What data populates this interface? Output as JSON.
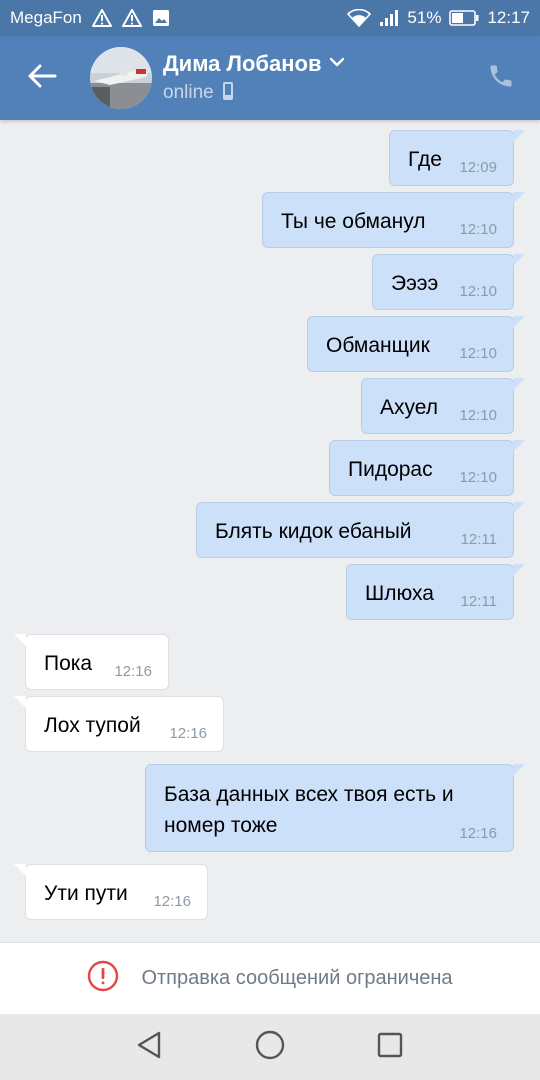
{
  "status_bar": {
    "carrier": "MegaFon",
    "battery": "51%",
    "time": "12:17"
  },
  "header": {
    "contact_name": "Дима Лобанов",
    "contact_status": "online"
  },
  "messages": [
    {
      "dir": "out",
      "text": "Где",
      "time": "12:09"
    },
    {
      "dir": "out",
      "text": "Ты че обманул",
      "time": "12:10"
    },
    {
      "dir": "out",
      "text": "Ээээ",
      "time": "12:10"
    },
    {
      "dir": "out",
      "text": "Обманщик",
      "time": "12:10"
    },
    {
      "dir": "out",
      "text": "Ахуел",
      "time": "12:10"
    },
    {
      "dir": "out",
      "text": "Пидорас",
      "time": "12:10"
    },
    {
      "dir": "out",
      "text": "Блять кидок ебаный",
      "time": "12:11"
    },
    {
      "dir": "out",
      "text": "Шлюха",
      "time": "12:11"
    },
    {
      "dir": "in",
      "text": "Пока",
      "time": "12:16"
    },
    {
      "dir": "in",
      "text": "Лох тупой",
      "time": "12:16"
    },
    {
      "dir": "out",
      "text": "База данных всех твоя есть и номер тоже",
      "time": "12:16"
    },
    {
      "dir": "in",
      "text": "Ути пути",
      "time": "12:16"
    }
  ],
  "footer": {
    "blocked_notice": "Отправка сообщений ограничена"
  },
  "colors": {
    "header_bg": "#5181b8",
    "status_bar_bg": "#4a76a8",
    "outgoing_bubble": "#cce0f9",
    "incoming_bubble": "#ffffff",
    "warning_red": "#e64646"
  },
  "icons": [
    "warning-icon",
    "image-icon",
    "wifi-icon",
    "signal-icon",
    "battery-icon",
    "back-arrow-icon",
    "chevron-down-icon",
    "mobile-phone-icon",
    "phone-call-icon",
    "error-circle-icon",
    "nav-back-icon",
    "nav-home-icon",
    "nav-recents-icon"
  ]
}
